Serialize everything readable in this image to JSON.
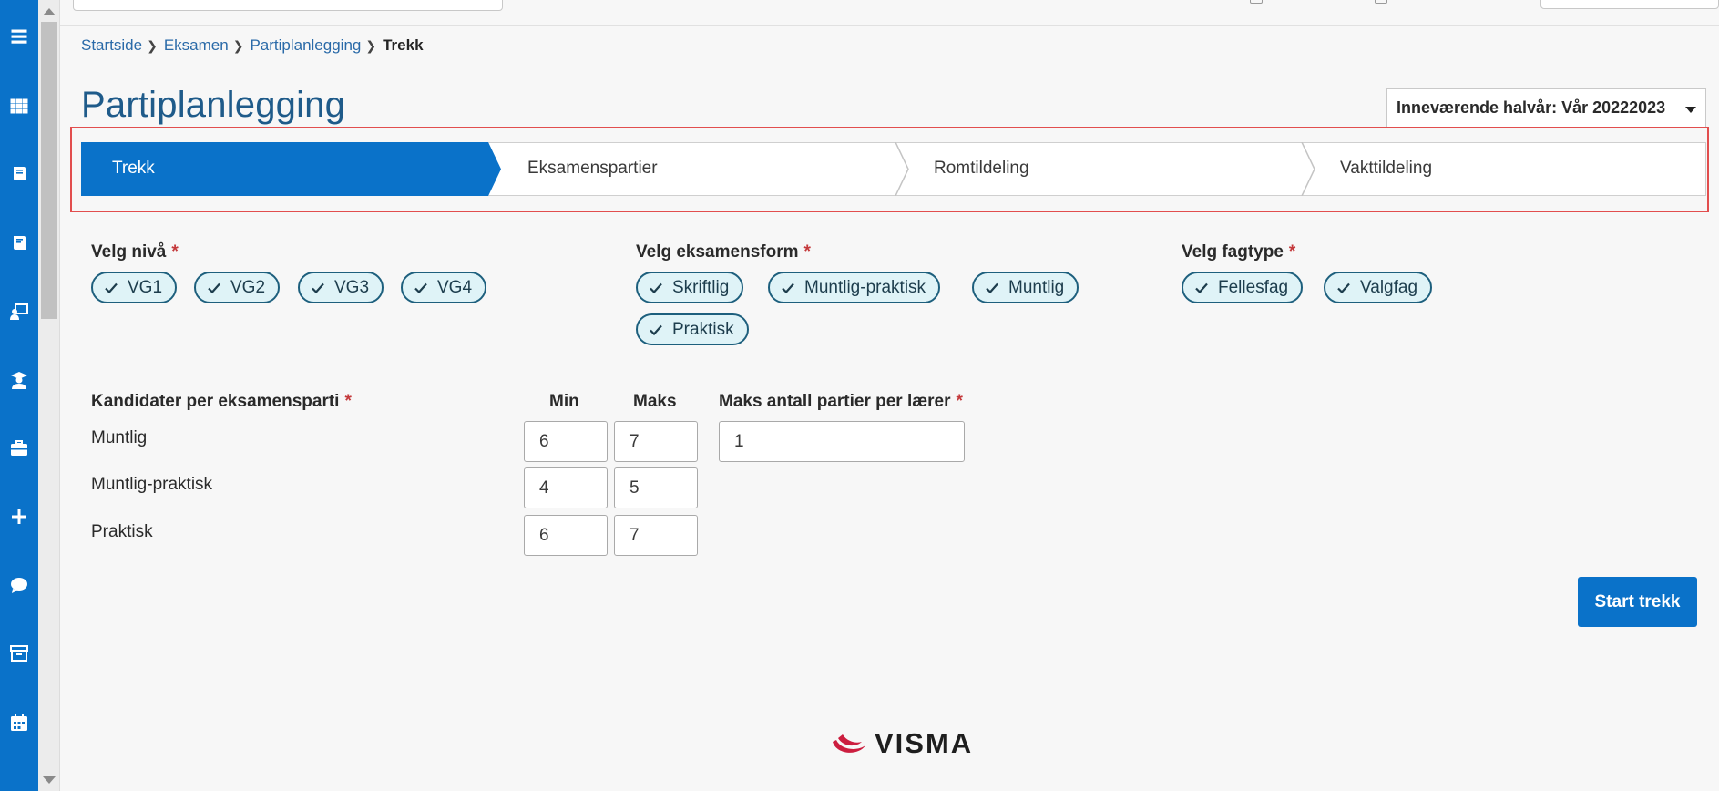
{
  "breadcrumb": {
    "items": [
      "Startside",
      "Eksamen",
      "Partiplanlegging"
    ],
    "current": "Trekk"
  },
  "page": {
    "title": "Partiplanlegging"
  },
  "semester": {
    "selected": "Inneværende halvår: Vår 20222023"
  },
  "stepper": {
    "steps": [
      "Trekk",
      "Eksamenspartier",
      "Romtildeling",
      "Vakttildeling"
    ],
    "active": "Trekk"
  },
  "filters": {
    "niva": {
      "label": "Velg nivå",
      "required": "*",
      "options": [
        "VG1",
        "VG2",
        "VG3",
        "VG4"
      ]
    },
    "eksamensform": {
      "label": "Velg eksamensform",
      "required": "*",
      "options": [
        "Skriftlig",
        "Muntlig-praktisk",
        "Muntlig",
        "Praktisk"
      ]
    },
    "fagtype": {
      "label": "Velg fagtype",
      "required": "*",
      "options": [
        "Fellesfag",
        "Valgfag"
      ]
    }
  },
  "candidates": {
    "label": "Kandidater per eksamensparti",
    "required": "*",
    "min_header": "Min",
    "max_header": "Maks",
    "rows": [
      {
        "name": "Muntlig",
        "min": "6",
        "max": "7"
      },
      {
        "name": "Muntlig-praktisk",
        "min": "4",
        "max": "5"
      },
      {
        "name": "Praktisk",
        "min": "6",
        "max": "7"
      }
    ]
  },
  "max_parties": {
    "label": "Maks antall partier per lærer",
    "required": "*",
    "value": "1"
  },
  "actions": {
    "start_label": "Start trekk"
  },
  "footer": {
    "brand": "VISMA"
  },
  "sidebar": {
    "icons": [
      "menu-icon",
      "apps-grid-icon",
      "book-icon",
      "notebook-icon",
      "teacher-icon",
      "graduate-icon",
      "briefcase-icon",
      "plus-icon",
      "chat-icon",
      "archive-icon",
      "calendar-icon"
    ]
  },
  "colors": {
    "primary": "#0a72c9",
    "chip_fill": "#dff3f7",
    "chip_border": "#1d5f7d",
    "highlight": "#e24e4e",
    "required": "#c4393b",
    "title": "#1f5b8a"
  }
}
